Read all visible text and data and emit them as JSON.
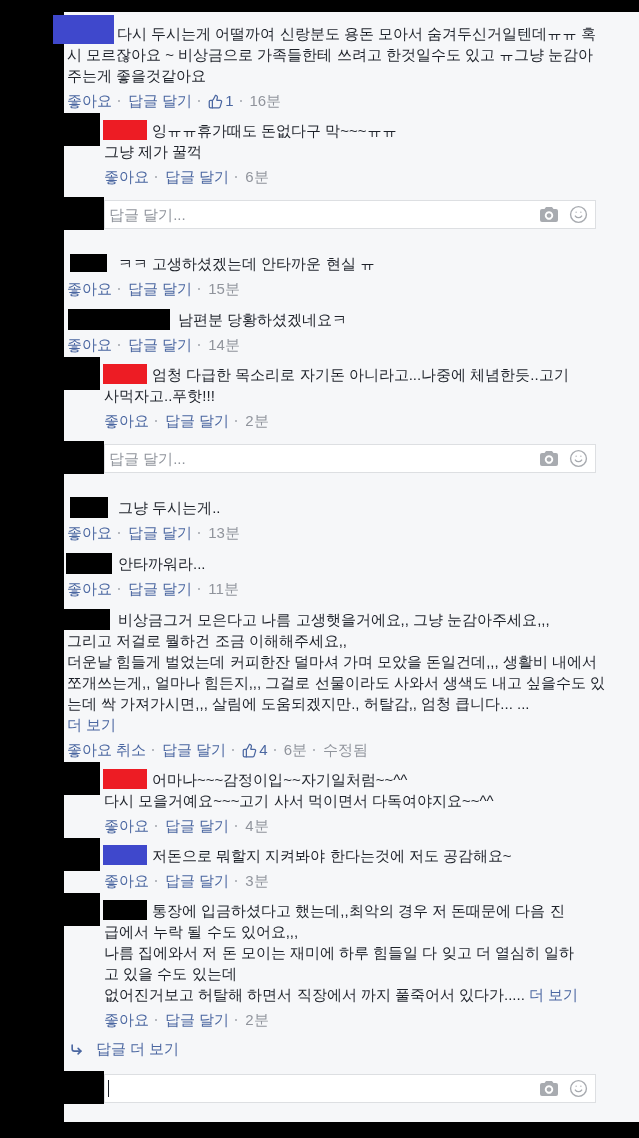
{
  "comments": [
    {
      "color": "#3f48cc",
      "text": "다시 두시는게 어떨까여 신랑분도 용돈 모아서 숨겨두신거일텐데ㅠㅠ 혹시 모르잖아요 ~ 비상금으로 가족들한테 쓰려고 한것일수도 있고 ㅠ그냥 눈감아주는게 좋을것같아요",
      "actions": [
        {
          "kind": "like",
          "label": "좋아요"
        },
        {
          "kind": "reply",
          "label": "답글 달기"
        },
        {
          "kind": "count",
          "label": "1"
        },
        {
          "kind": "time",
          "label": "16분"
        }
      ],
      "replies": [
        {
          "color": "#ed1c24",
          "text": "잉ㅠㅠ휴가때도 돈없다구 막~~~ㅠㅠ\n그냥 제가 꿀꺽",
          "actions": [
            {
              "kind": "like",
              "label": "좋아요"
            },
            {
              "kind": "reply",
              "label": "답글 달기"
            },
            {
              "kind": "time",
              "label": "6분"
            }
          ]
        }
      ],
      "reply_box": {
        "placeholder": "답글 달기...",
        "focused": false
      }
    },
    {
      "color": "#000000",
      "text": "ㅋㅋ 고생하셨겠는데 안타까운 현실 ㅠ",
      "actions": [
        {
          "kind": "like",
          "label": "좋아요"
        },
        {
          "kind": "reply",
          "label": "답글 달기"
        },
        {
          "kind": "time",
          "label": "15분"
        }
      ]
    },
    {
      "color": "#000000",
      "text": "남편분 당황하셨겠네요ㅋ",
      "actions": [
        {
          "kind": "like",
          "label": "좋아요"
        },
        {
          "kind": "reply",
          "label": "답글 달기"
        },
        {
          "kind": "time",
          "label": "14분"
        }
      ],
      "replies": [
        {
          "color": "#ed1c24",
          "text": "엄청 다급한 목소리로 자기돈 아니라고...나중에 체념한듯..고기 사먹자고..푸핫!!!",
          "actions": [
            {
              "kind": "like",
              "label": "좋아요"
            },
            {
              "kind": "reply",
              "label": "답글 달기"
            },
            {
              "kind": "time",
              "label": "2분"
            }
          ]
        }
      ],
      "reply_box": {
        "placeholder": "답글 달기...",
        "focused": false
      }
    },
    {
      "color": "#000000",
      "text": "그냥 두시는게..",
      "actions": [
        {
          "kind": "like",
          "label": "좋아요"
        },
        {
          "kind": "reply",
          "label": "답글 달기"
        },
        {
          "kind": "time",
          "label": "13분"
        }
      ]
    },
    {
      "color": "#000000",
      "text": "안타까워라...",
      "actions": [
        {
          "kind": "like",
          "label": "좋아요"
        },
        {
          "kind": "reply",
          "label": "답글 달기"
        },
        {
          "kind": "time",
          "label": "11분"
        }
      ]
    },
    {
      "color": "#000000",
      "text": "비상금그거 모은다고 나름 고생햇을거에요,, 그냥 눈감아주세요,,,\n그리고 저걸로 뭘하건 조금 이해해주세요,,\n더운날 힘들게 벌었는데 커피한잔 덜마셔 가며 모았을 돈일건데,,, 생활비 내에서 쪼개쓰는게,, 얼마나 힘든지,,, 그걸로 선물이라도 사와서 생색도 내고 싶을수도 있는데 싹 가져가시면,,, 살림에 도움되겠지만., 허탈감,, 엄청 큽니다... ...",
      "see_more": {
        "kind": "line",
        "label": "더 보기"
      },
      "actions": [
        {
          "kind": "like",
          "label": "좋아요 취소"
        },
        {
          "kind": "reply",
          "label": "답글 달기"
        },
        {
          "kind": "count",
          "label": "4"
        },
        {
          "kind": "time",
          "label": "6분"
        },
        {
          "kind": "edited",
          "label": "수정됨"
        }
      ],
      "replies": [
        {
          "color": "#ed1c24",
          "text": "어마나~~~감정이입~~자기일처럼~~^^\n다시 모을거예요~~~고기 사서 먹이면서 다독여야지요~~^^",
          "actions": [
            {
              "kind": "like",
              "label": "좋아요"
            },
            {
              "kind": "reply",
              "label": "답글 달기"
            },
            {
              "kind": "time",
              "label": "4분"
            }
          ]
        },
        {
          "color": "#3f48cc",
          "text": "저돈으로 뭐할지 지켜봐야 한다는것에 저도 공감해요~",
          "actions": [
            {
              "kind": "like",
              "label": "좋아요"
            },
            {
              "kind": "reply",
              "label": "답글 달기"
            },
            {
              "kind": "time",
              "label": "3분"
            }
          ]
        },
        {
          "color": "#000000",
          "text": "통장에 입금하셨다고 했는데,,최악의 경우 저 돈때문에 다음 진급에서 누락 될 수도 있어요,,,\n나름 집에와서 저 돈 모이는 재미에 하루 힘들일 다 잊고 더 열심히 일하고 있을 수도 있는데\n없어진거보고 허탈해 하면서 직장에서 까지 풀죽어서 있다가.....",
          "see_more": {
            "kind": "inline",
            "label": "더 보기"
          },
          "actions": [
            {
              "kind": "like",
              "label": "좋아요"
            },
            {
              "kind": "reply",
              "label": "답글 달기"
            },
            {
              "kind": "time",
              "label": "2분"
            }
          ]
        }
      ],
      "more_replies": "답글 더 보기",
      "reply_box": {
        "focused": true
      }
    }
  ]
}
